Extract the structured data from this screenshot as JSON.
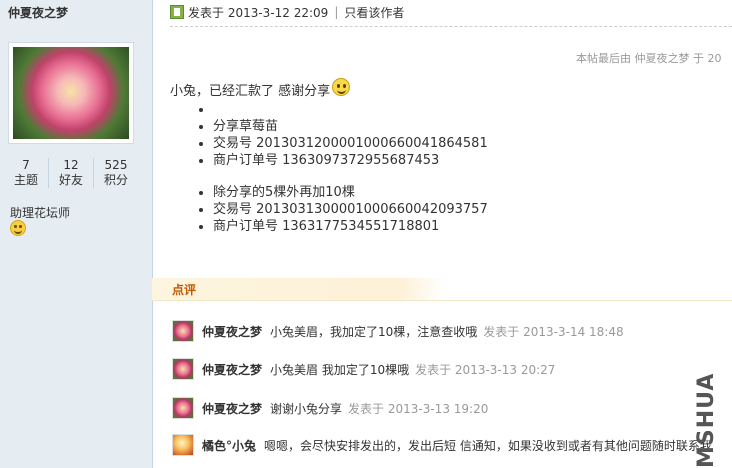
{
  "sidebar": {
    "username": "仲夏夜之梦",
    "stats": [
      {
        "value": "7",
        "label": "主题"
      },
      {
        "value": "12",
        "label": "好友"
      },
      {
        "value": "525",
        "label": "积分"
      }
    ],
    "group": "助理花坛师",
    "group_icon": "smiley-icon"
  },
  "post": {
    "posted_at": "发表于 2013-3-12 22:09",
    "author_only": "只看该作者",
    "last_edit": "本帖最后由 仲夏夜之梦 于 20",
    "message": "小兔，已经汇款了   感谢分享",
    "items": [
      "分享草莓苗",
      "交易号 2013031200001000660041864581",
      "商户订单号 1363097372955687453",
      "除分享的5棵外再加10棵",
      "交易号 2013031300001000660042093757",
      "商户订单号 1363177534551718801"
    ]
  },
  "comments": {
    "title": "点评",
    "list": [
      {
        "author": "仲夏夜之梦",
        "text": "小兔美眉，我加定了10棵，注意查收哦",
        "time": "发表于 2013-3-14 18:48"
      },
      {
        "author": "仲夏夜之梦",
        "text": "小兔美眉 我加定了10棵哦",
        "time": "发表于 2013-3-13 20:27"
      },
      {
        "author": "仲夏夜之梦",
        "text": "谢谢小兔分享",
        "time": "发表于 2013-3-13 19:20"
      },
      {
        "author": "橘色°小兔",
        "text": "嗯嗯，会尽快安排发出的，发出后短 信通知，如果没收到或者有其他问题随时联系我",
        "time": ""
      }
    ]
  },
  "watermark": "MSHUA"
}
